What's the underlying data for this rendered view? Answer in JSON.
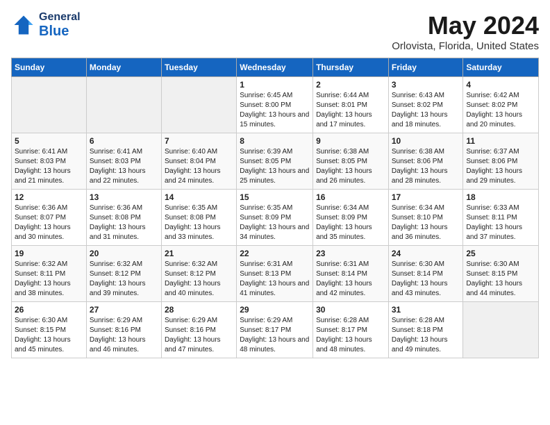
{
  "app": {
    "name_general": "General",
    "name_blue": "Blue",
    "title": "May 2024",
    "subtitle": "Orlovista, Florida, United States"
  },
  "calendar": {
    "days_of_week": [
      "Sunday",
      "Monday",
      "Tuesday",
      "Wednesday",
      "Thursday",
      "Friday",
      "Saturday"
    ],
    "weeks": [
      [
        {
          "day": "",
          "sunrise": "",
          "sunset": "",
          "daylight": ""
        },
        {
          "day": "",
          "sunrise": "",
          "sunset": "",
          "daylight": ""
        },
        {
          "day": "",
          "sunrise": "",
          "sunset": "",
          "daylight": ""
        },
        {
          "day": "1",
          "sunrise": "Sunrise: 6:45 AM",
          "sunset": "Sunset: 8:00 PM",
          "daylight": "Daylight: 13 hours and 15 minutes."
        },
        {
          "day": "2",
          "sunrise": "Sunrise: 6:44 AM",
          "sunset": "Sunset: 8:01 PM",
          "daylight": "Daylight: 13 hours and 17 minutes."
        },
        {
          "day": "3",
          "sunrise": "Sunrise: 6:43 AM",
          "sunset": "Sunset: 8:02 PM",
          "daylight": "Daylight: 13 hours and 18 minutes."
        },
        {
          "day": "4",
          "sunrise": "Sunrise: 6:42 AM",
          "sunset": "Sunset: 8:02 PM",
          "daylight": "Daylight: 13 hours and 20 minutes."
        }
      ],
      [
        {
          "day": "5",
          "sunrise": "Sunrise: 6:41 AM",
          "sunset": "Sunset: 8:03 PM",
          "daylight": "Daylight: 13 hours and 21 minutes."
        },
        {
          "day": "6",
          "sunrise": "Sunrise: 6:41 AM",
          "sunset": "Sunset: 8:03 PM",
          "daylight": "Daylight: 13 hours and 22 minutes."
        },
        {
          "day": "7",
          "sunrise": "Sunrise: 6:40 AM",
          "sunset": "Sunset: 8:04 PM",
          "daylight": "Daylight: 13 hours and 24 minutes."
        },
        {
          "day": "8",
          "sunrise": "Sunrise: 6:39 AM",
          "sunset": "Sunset: 8:05 PM",
          "daylight": "Daylight: 13 hours and 25 minutes."
        },
        {
          "day": "9",
          "sunrise": "Sunrise: 6:38 AM",
          "sunset": "Sunset: 8:05 PM",
          "daylight": "Daylight: 13 hours and 26 minutes."
        },
        {
          "day": "10",
          "sunrise": "Sunrise: 6:38 AM",
          "sunset": "Sunset: 8:06 PM",
          "daylight": "Daylight: 13 hours and 28 minutes."
        },
        {
          "day": "11",
          "sunrise": "Sunrise: 6:37 AM",
          "sunset": "Sunset: 8:06 PM",
          "daylight": "Daylight: 13 hours and 29 minutes."
        }
      ],
      [
        {
          "day": "12",
          "sunrise": "Sunrise: 6:36 AM",
          "sunset": "Sunset: 8:07 PM",
          "daylight": "Daylight: 13 hours and 30 minutes."
        },
        {
          "day": "13",
          "sunrise": "Sunrise: 6:36 AM",
          "sunset": "Sunset: 8:08 PM",
          "daylight": "Daylight: 13 hours and 31 minutes."
        },
        {
          "day": "14",
          "sunrise": "Sunrise: 6:35 AM",
          "sunset": "Sunset: 8:08 PM",
          "daylight": "Daylight: 13 hours and 33 minutes."
        },
        {
          "day": "15",
          "sunrise": "Sunrise: 6:35 AM",
          "sunset": "Sunset: 8:09 PM",
          "daylight": "Daylight: 13 hours and 34 minutes."
        },
        {
          "day": "16",
          "sunrise": "Sunrise: 6:34 AM",
          "sunset": "Sunset: 8:09 PM",
          "daylight": "Daylight: 13 hours and 35 minutes."
        },
        {
          "day": "17",
          "sunrise": "Sunrise: 6:34 AM",
          "sunset": "Sunset: 8:10 PM",
          "daylight": "Daylight: 13 hours and 36 minutes."
        },
        {
          "day": "18",
          "sunrise": "Sunrise: 6:33 AM",
          "sunset": "Sunset: 8:11 PM",
          "daylight": "Daylight: 13 hours and 37 minutes."
        }
      ],
      [
        {
          "day": "19",
          "sunrise": "Sunrise: 6:32 AM",
          "sunset": "Sunset: 8:11 PM",
          "daylight": "Daylight: 13 hours and 38 minutes."
        },
        {
          "day": "20",
          "sunrise": "Sunrise: 6:32 AM",
          "sunset": "Sunset: 8:12 PM",
          "daylight": "Daylight: 13 hours and 39 minutes."
        },
        {
          "day": "21",
          "sunrise": "Sunrise: 6:32 AM",
          "sunset": "Sunset: 8:12 PM",
          "daylight": "Daylight: 13 hours and 40 minutes."
        },
        {
          "day": "22",
          "sunrise": "Sunrise: 6:31 AM",
          "sunset": "Sunset: 8:13 PM",
          "daylight": "Daylight: 13 hours and 41 minutes."
        },
        {
          "day": "23",
          "sunrise": "Sunrise: 6:31 AM",
          "sunset": "Sunset: 8:14 PM",
          "daylight": "Daylight: 13 hours and 42 minutes."
        },
        {
          "day": "24",
          "sunrise": "Sunrise: 6:30 AM",
          "sunset": "Sunset: 8:14 PM",
          "daylight": "Daylight: 13 hours and 43 minutes."
        },
        {
          "day": "25",
          "sunrise": "Sunrise: 6:30 AM",
          "sunset": "Sunset: 8:15 PM",
          "daylight": "Daylight: 13 hours and 44 minutes."
        }
      ],
      [
        {
          "day": "26",
          "sunrise": "Sunrise: 6:30 AM",
          "sunset": "Sunset: 8:15 PM",
          "daylight": "Daylight: 13 hours and 45 minutes."
        },
        {
          "day": "27",
          "sunrise": "Sunrise: 6:29 AM",
          "sunset": "Sunset: 8:16 PM",
          "daylight": "Daylight: 13 hours and 46 minutes."
        },
        {
          "day": "28",
          "sunrise": "Sunrise: 6:29 AM",
          "sunset": "Sunset: 8:16 PM",
          "daylight": "Daylight: 13 hours and 47 minutes."
        },
        {
          "day": "29",
          "sunrise": "Sunrise: 6:29 AM",
          "sunset": "Sunset: 8:17 PM",
          "daylight": "Daylight: 13 hours and 48 minutes."
        },
        {
          "day": "30",
          "sunrise": "Sunrise: 6:28 AM",
          "sunset": "Sunset: 8:17 PM",
          "daylight": "Daylight: 13 hours and 48 minutes."
        },
        {
          "day": "31",
          "sunrise": "Sunrise: 6:28 AM",
          "sunset": "Sunset: 8:18 PM",
          "daylight": "Daylight: 13 hours and 49 minutes."
        },
        {
          "day": "",
          "sunrise": "",
          "sunset": "",
          "daylight": ""
        }
      ]
    ]
  }
}
